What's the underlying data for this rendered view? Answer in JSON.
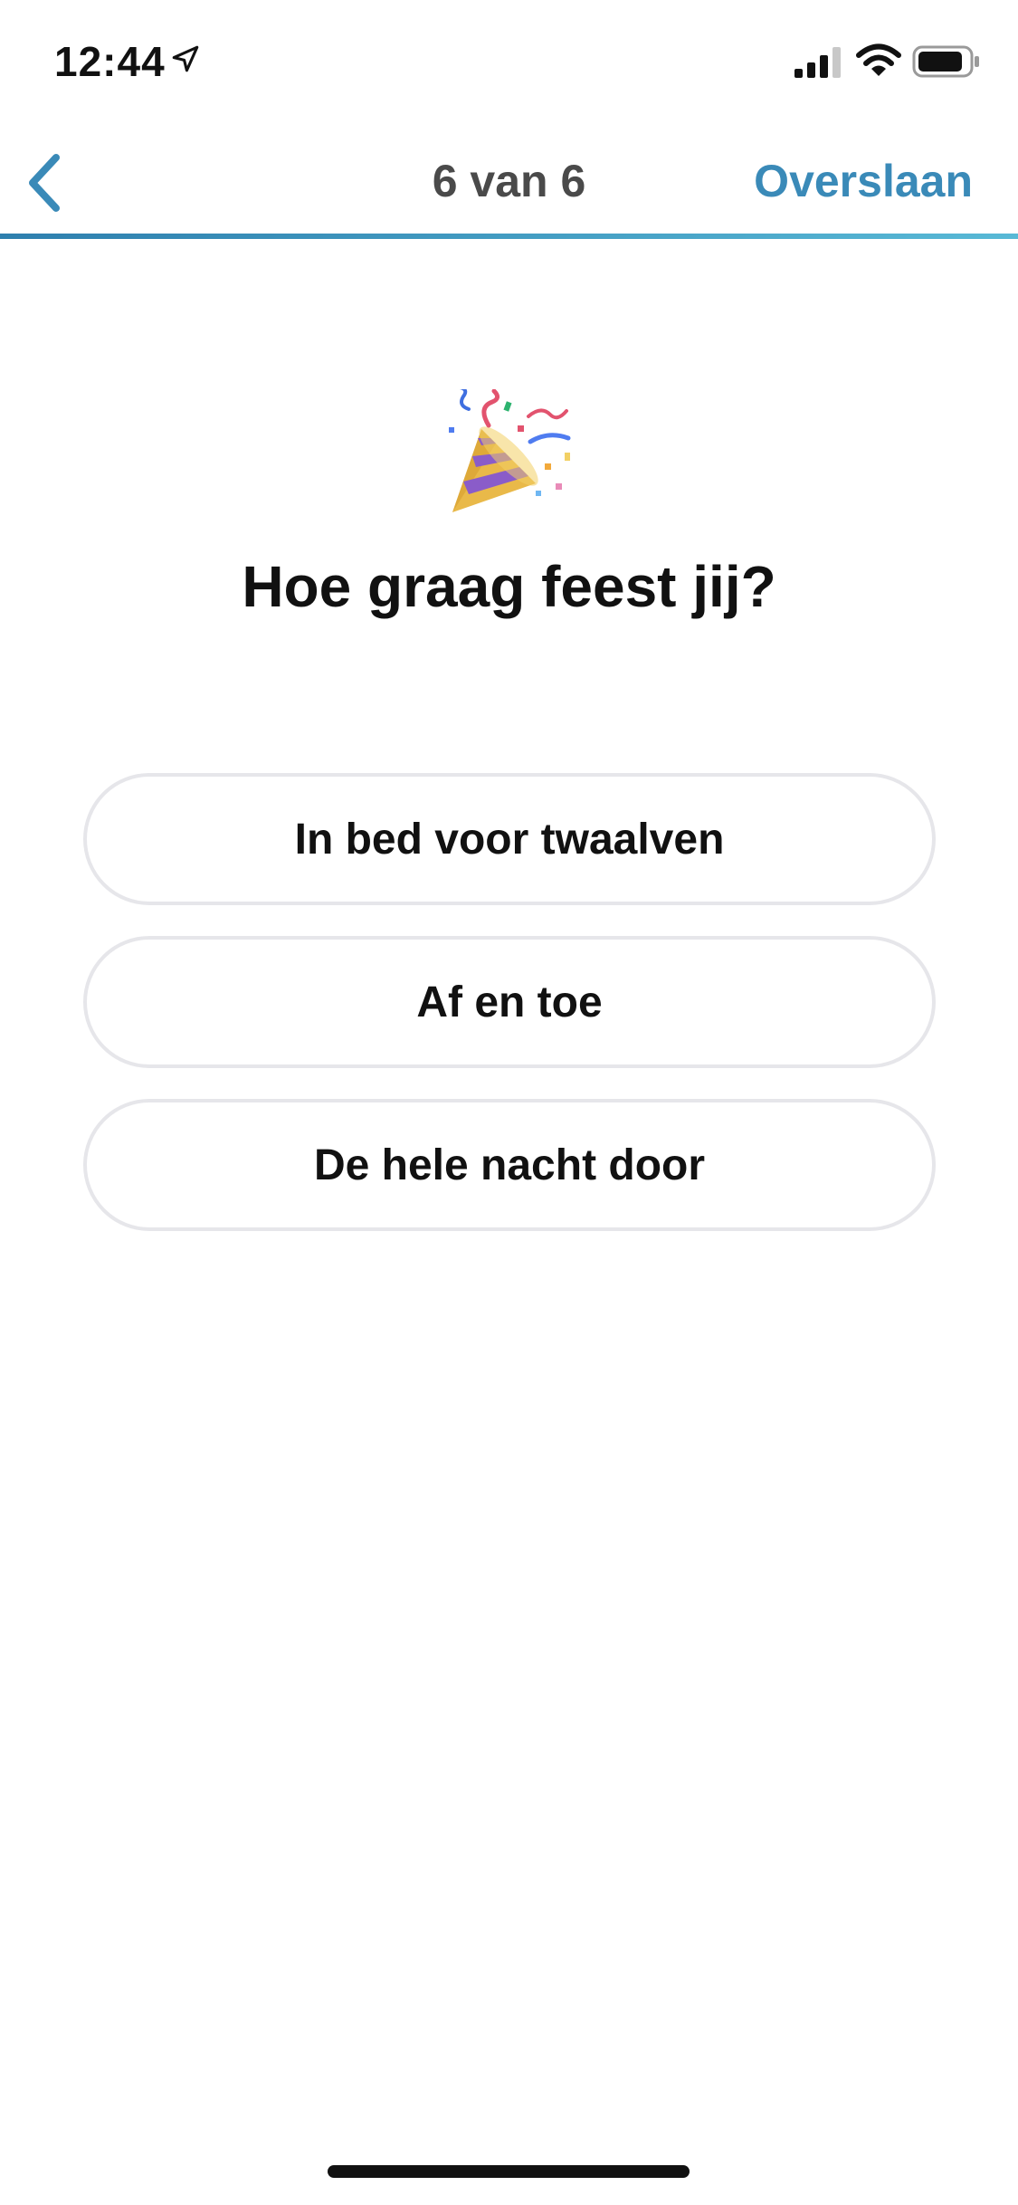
{
  "status_bar": {
    "time": "12:44",
    "icons": [
      "location-arrow-icon",
      "signal-bars-icon",
      "wifi-icon",
      "battery-icon"
    ]
  },
  "nav": {
    "back_icon": "chevron-left-icon",
    "step_label": "6 van 6",
    "skip_label": "Overslaan",
    "progress_fraction": 1.0
  },
  "question": {
    "emoji": "party-popper",
    "title": "Hoe graag feest jij?"
  },
  "options": [
    {
      "label": "In bed voor twaalven"
    },
    {
      "label": "Af en toe"
    },
    {
      "label": "De hele nacht door"
    }
  ],
  "colors": {
    "accent": "#3a8ab8",
    "option_border": "#e6e6ea",
    "text": "#111111",
    "muted_text": "#4a4a4a"
  }
}
